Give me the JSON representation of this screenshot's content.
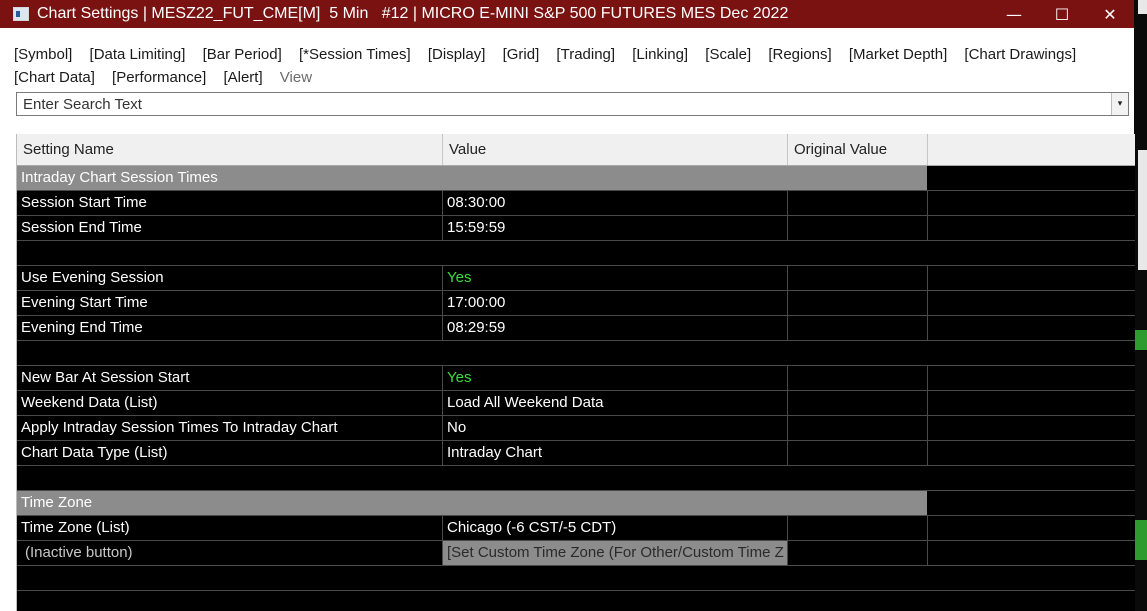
{
  "window": {
    "title": "Chart Settings | MESZ22_FUT_CME[M]  5 Min   #12 | MICRO E-MINI S&P 500 FUTURES MES Dec 2022",
    "minimize_glyph": "—",
    "maximize_glyph": "☐",
    "close_glyph": "✕"
  },
  "menu": {
    "items": [
      "[Symbol]",
      "[Data Limiting]",
      "[Bar Period]",
      "[*Session Times]",
      "[Display]",
      "[Grid]",
      "[Trading]",
      "[Linking]",
      "[Scale]",
      "[Regions]",
      "[Market Depth]",
      "[Chart Drawings]",
      "[Chart Data]",
      "[Performance]",
      "[Alert]",
      "View"
    ]
  },
  "search": {
    "placeholder": "Enter Search Text",
    "dropdown_glyph": "▾"
  },
  "table": {
    "headers": [
      "Setting Name",
      "Value",
      "Original Value",
      ""
    ],
    "sections": {
      "intraday": "Intraday Chart Session Times",
      "timezone": "Time Zone"
    },
    "rows": {
      "session_start": {
        "name": "Session Start Time",
        "value": "08:30:00"
      },
      "session_end": {
        "name": "Session End Time",
        "value": "15:59:59"
      },
      "use_evening": {
        "name": "Use Evening Session",
        "value": "Yes"
      },
      "evening_start": {
        "name": "Evening Start Time",
        "value": "17:00:00"
      },
      "evening_end": {
        "name": "Evening End Time",
        "value": "08:29:59"
      },
      "new_bar": {
        "name": "New Bar At Session Start",
        "value": "Yes"
      },
      "weekend": {
        "name": "Weekend Data (List)",
        "value": "Load All Weekend Data"
      },
      "apply_intraday": {
        "name": "Apply Intraday Session Times To Intraday Chart",
        "value": "No"
      },
      "data_type": {
        "name": "Chart Data Type (List)",
        "value": "Intraday Chart"
      },
      "tz_list": {
        "name": "Time Zone (List)",
        "value": "Chicago (-6 CST/-5 CDT)"
      },
      "inactive": {
        "name": "(Inactive button)",
        "value": "[Set Custom Time Zone (For Other/Custom Time Z"
      }
    }
  },
  "colors": {
    "titlebar": "#7a1212",
    "grid_background": "#000000",
    "section_header": "#8c8c8c",
    "yes_value": "#3ddc3d"
  }
}
